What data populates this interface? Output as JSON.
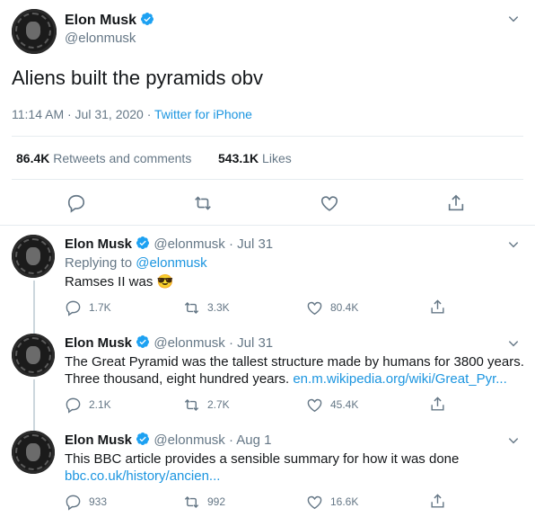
{
  "main_tweet": {
    "name": "Elon Musk",
    "handle": "@elonmusk",
    "text": "Aliens built the pyramids obv",
    "time": "11:14 AM · Jul 31, 2020 · ",
    "source": "Twitter for iPhone",
    "retweets_count": "86.4K",
    "retweets_label": "Retweets and comments",
    "likes_count": "543.1K",
    "likes_label": "Likes"
  },
  "replies": [
    {
      "name": "Elon Musk",
      "handle_date": "@elonmusk · Jul 31",
      "replying_prefix": "Replying to ",
      "replying_to": "@elonmusk",
      "text": "Ramses II was 😎",
      "reply_count": "1.7K",
      "retweet_count": "3.3K",
      "like_count": "80.4K"
    },
    {
      "name": "Elon Musk",
      "handle_date": "@elonmusk · Jul 31",
      "text_line1": "The Great Pyramid was the tallest structure made by humans for 3800 years.",
      "text_line2": "Three thousand, eight hundred years. ",
      "link": "en.m.wikipedia.org/wiki/Great_Pyr...",
      "reply_count": "2.1K",
      "retweet_count": "2.7K",
      "like_count": "45.4K"
    },
    {
      "name": "Elon Musk",
      "handle_date": "@elonmusk · Aug 1",
      "text_line1": "This BBC article provides a sensible summary for how it was done",
      "link": "bbc.co.uk/history/ancien...",
      "reply_count": "933",
      "retweet_count": "992",
      "like_count": "16.6K"
    }
  ],
  "colors": {
    "accent": "#1b95e0",
    "muted": "#657786",
    "text": "#14171a"
  }
}
